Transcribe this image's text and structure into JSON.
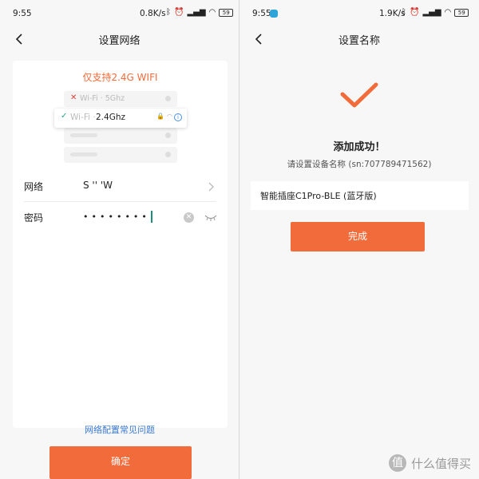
{
  "left_screen": {
    "status": {
      "time": "9:55",
      "speed": "0.8K/s",
      "battery": "59"
    },
    "title": "设置网络",
    "notice": "仅支持2.4G WIFI",
    "illustration": {
      "row_5g_prefix": "Wi-Fi · ",
      "row_5g_freq": "5Ghz",
      "row_24_prefix": "Wi-Fi · ",
      "row_24_freq": "2.4Ghz"
    },
    "network_label": "网络",
    "network_value": "S       '' 'W",
    "password_label": "密码",
    "password_value": "••••••••",
    "faq_link": "网络配置常见问题",
    "confirm_button": "确定"
  },
  "right_screen": {
    "status": {
      "time": "9:55",
      "speed": "1.9K/s",
      "battery": "59"
    },
    "title": "设置名称",
    "success_text": "添加成功！",
    "hint_text": "请设置设备名称 (sn:707789471562)",
    "device_name": "智能插座C1Pro-BLE (蓝牙版)",
    "done_button": "完成"
  },
  "watermark": {
    "icon_text": "值",
    "text": "什么值得买"
  },
  "colors": {
    "accent": "#f26b3a",
    "link": "#3a7bd5",
    "check_green": "#26a38a"
  }
}
